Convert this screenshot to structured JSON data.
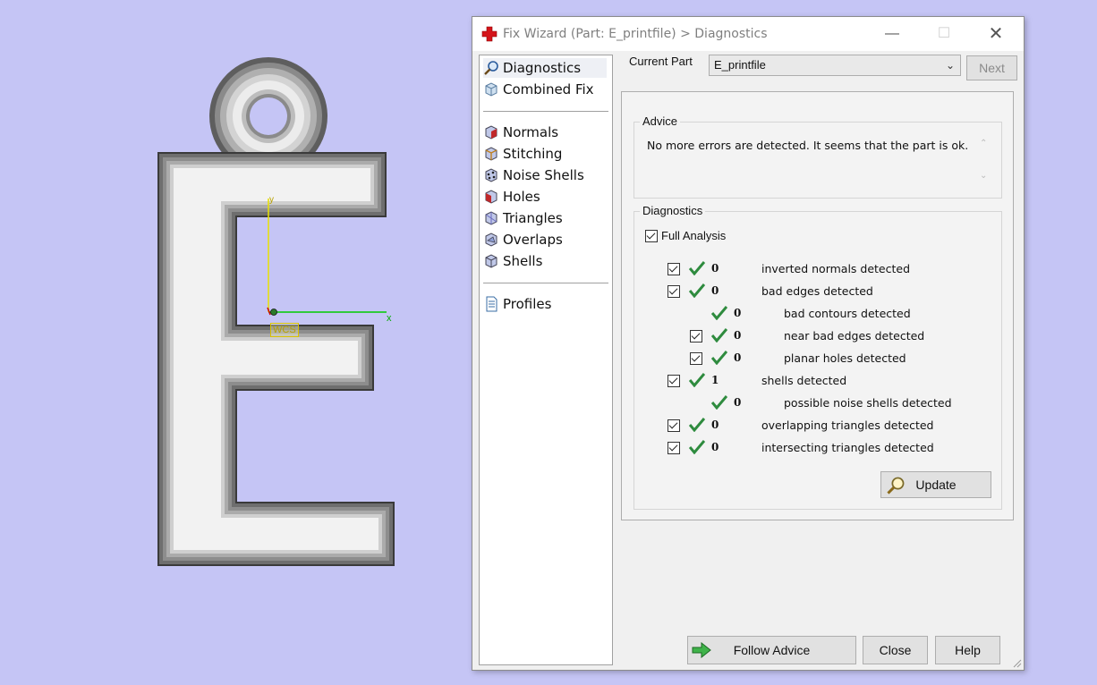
{
  "viewport": {
    "wcs_label": "WCS",
    "axis_x": "x",
    "axis_y": "y"
  },
  "dialog": {
    "title": "Fix Wizard (Part: E_printfile) > Diagnostics",
    "tree": {
      "group1": [
        {
          "label": "Diagnostics",
          "icon": "magnifier-icon",
          "selected": true
        },
        {
          "label": "Combined Fix",
          "icon": "cube-icon"
        }
      ],
      "group2": [
        {
          "label": "Normals",
          "icon": "normals-icon"
        },
        {
          "label": "Stitching",
          "icon": "stitching-icon"
        },
        {
          "label": "Noise Shells",
          "icon": "noise-shells-icon"
        },
        {
          "label": "Holes",
          "icon": "holes-icon"
        },
        {
          "label": "Triangles",
          "icon": "triangles-icon"
        },
        {
          "label": "Overlaps",
          "icon": "overlaps-icon"
        },
        {
          "label": "Shells",
          "icon": "shells-icon"
        }
      ],
      "group3": [
        {
          "label": "Profiles",
          "icon": "document-icon"
        }
      ]
    },
    "current_part": {
      "label": "Current Part",
      "value": "E_printfile"
    },
    "next_label": "Next",
    "advice": {
      "title": "Advice",
      "text": "No more errors are detected. It seems that the part is ok."
    },
    "diagnostics": {
      "title": "Diagnostics",
      "full_analysis": "Full Analysis",
      "rows": [
        {
          "checkbox": true,
          "count": "0",
          "label": "inverted normals detected",
          "indent": 0
        },
        {
          "checkbox": true,
          "count": "0",
          "label": "bad edges detected",
          "indent": 0
        },
        {
          "checkbox": false,
          "count": "0",
          "label": "bad contours detected",
          "indent": 1
        },
        {
          "checkbox": true,
          "count": "0",
          "label": "near bad edges detected",
          "indent": 1
        },
        {
          "checkbox": true,
          "count": "0",
          "label": "planar holes detected",
          "indent": 1
        },
        {
          "checkbox": true,
          "count": "1",
          "label": "shells detected",
          "indent": 0
        },
        {
          "checkbox": false,
          "count": "0",
          "label": "possible noise shells detected",
          "indent": 1
        },
        {
          "checkbox": true,
          "count": "0",
          "label": "overlapping triangles detected",
          "indent": 0
        },
        {
          "checkbox": true,
          "count": "0",
          "label": "intersecting triangles detected",
          "indent": 0
        }
      ],
      "update_label": "Update"
    },
    "buttons": {
      "follow_advice": "Follow Advice",
      "close": "Close",
      "help": "Help"
    }
  }
}
